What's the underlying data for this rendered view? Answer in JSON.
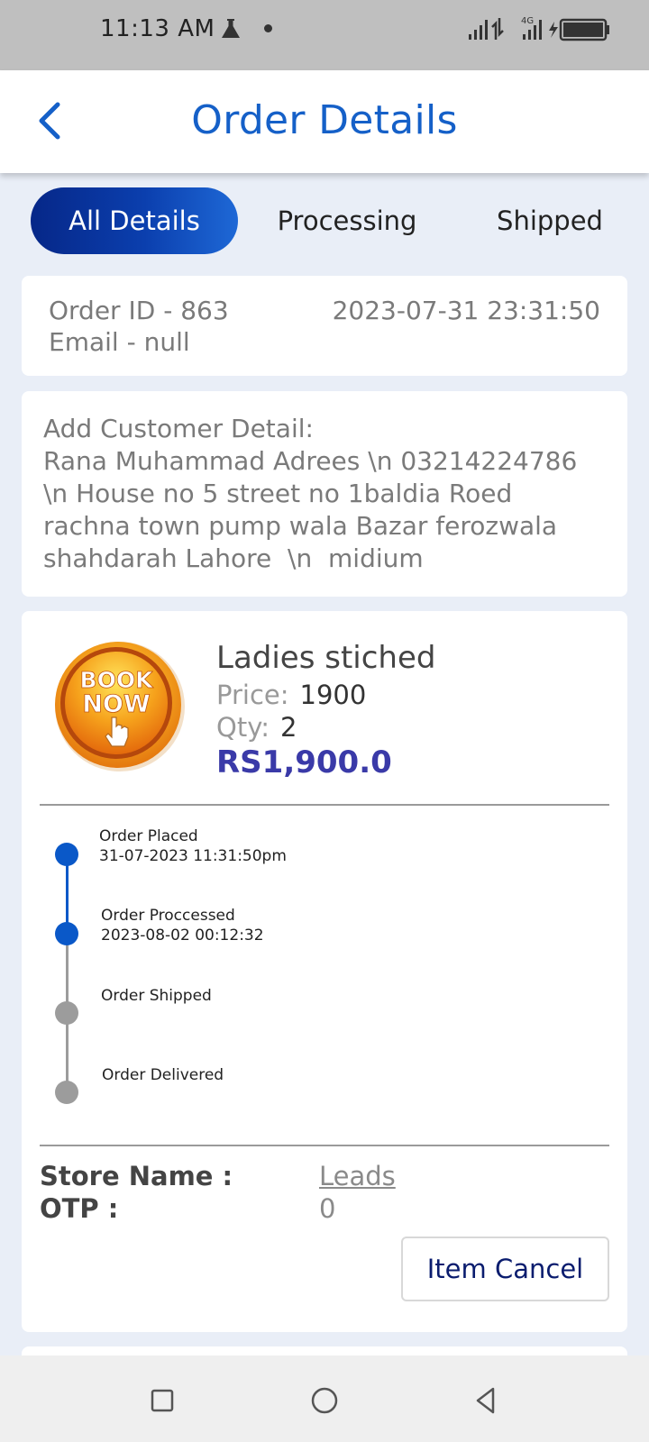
{
  "status_bar": {
    "time": "11:13 AM",
    "network_label": "4G"
  },
  "header": {
    "title": "Order Details"
  },
  "tabs": [
    {
      "label": "All Details",
      "active": true
    },
    {
      "label": "Processing",
      "active": false
    },
    {
      "label": "Shipped",
      "active": false
    }
  ],
  "order": {
    "id_text": "Order ID - 863",
    "email_text": "Email - null",
    "datetime": "2023-07-31 23:31:50"
  },
  "customer": {
    "text": "Add Customer Detail:\nRana Muhammad Adrees \\n 03214224786 \\n House no 5 street no 1baldia Roed rachna town pump wala Bazar ferozwala shahdarah Lahore  \\n  midium"
  },
  "item": {
    "image_text_line1": "BOOK",
    "image_text_line2": "NOW",
    "name": "Ladies stiched",
    "price_label": "Price:",
    "price_value": "1900",
    "qty_label": "Qty:",
    "qty_value": "2",
    "total": "RS1,900.0"
  },
  "timeline": [
    {
      "title": "Order Placed",
      "date": "31-07-2023 11:31:50pm",
      "done": true
    },
    {
      "title": "Order Proccessed",
      "date": "2023-08-02 00:12:32",
      "done": true
    },
    {
      "title": "Order Shipped",
      "date": "",
      "done": false
    },
    {
      "title": "Order Delivered",
      "date": "",
      "done": false
    }
  ],
  "store": {
    "store_label": "Store Name :",
    "store_value": "Leads",
    "otp_label": "OTP :",
    "otp_value": "0"
  },
  "actions": {
    "cancel_label": "Item Cancel"
  },
  "colors": {
    "primary": "#1560c8",
    "active_dot": "#0a58c8",
    "inactive_dot": "#9c9c9c",
    "total": "#3a3aa8"
  }
}
